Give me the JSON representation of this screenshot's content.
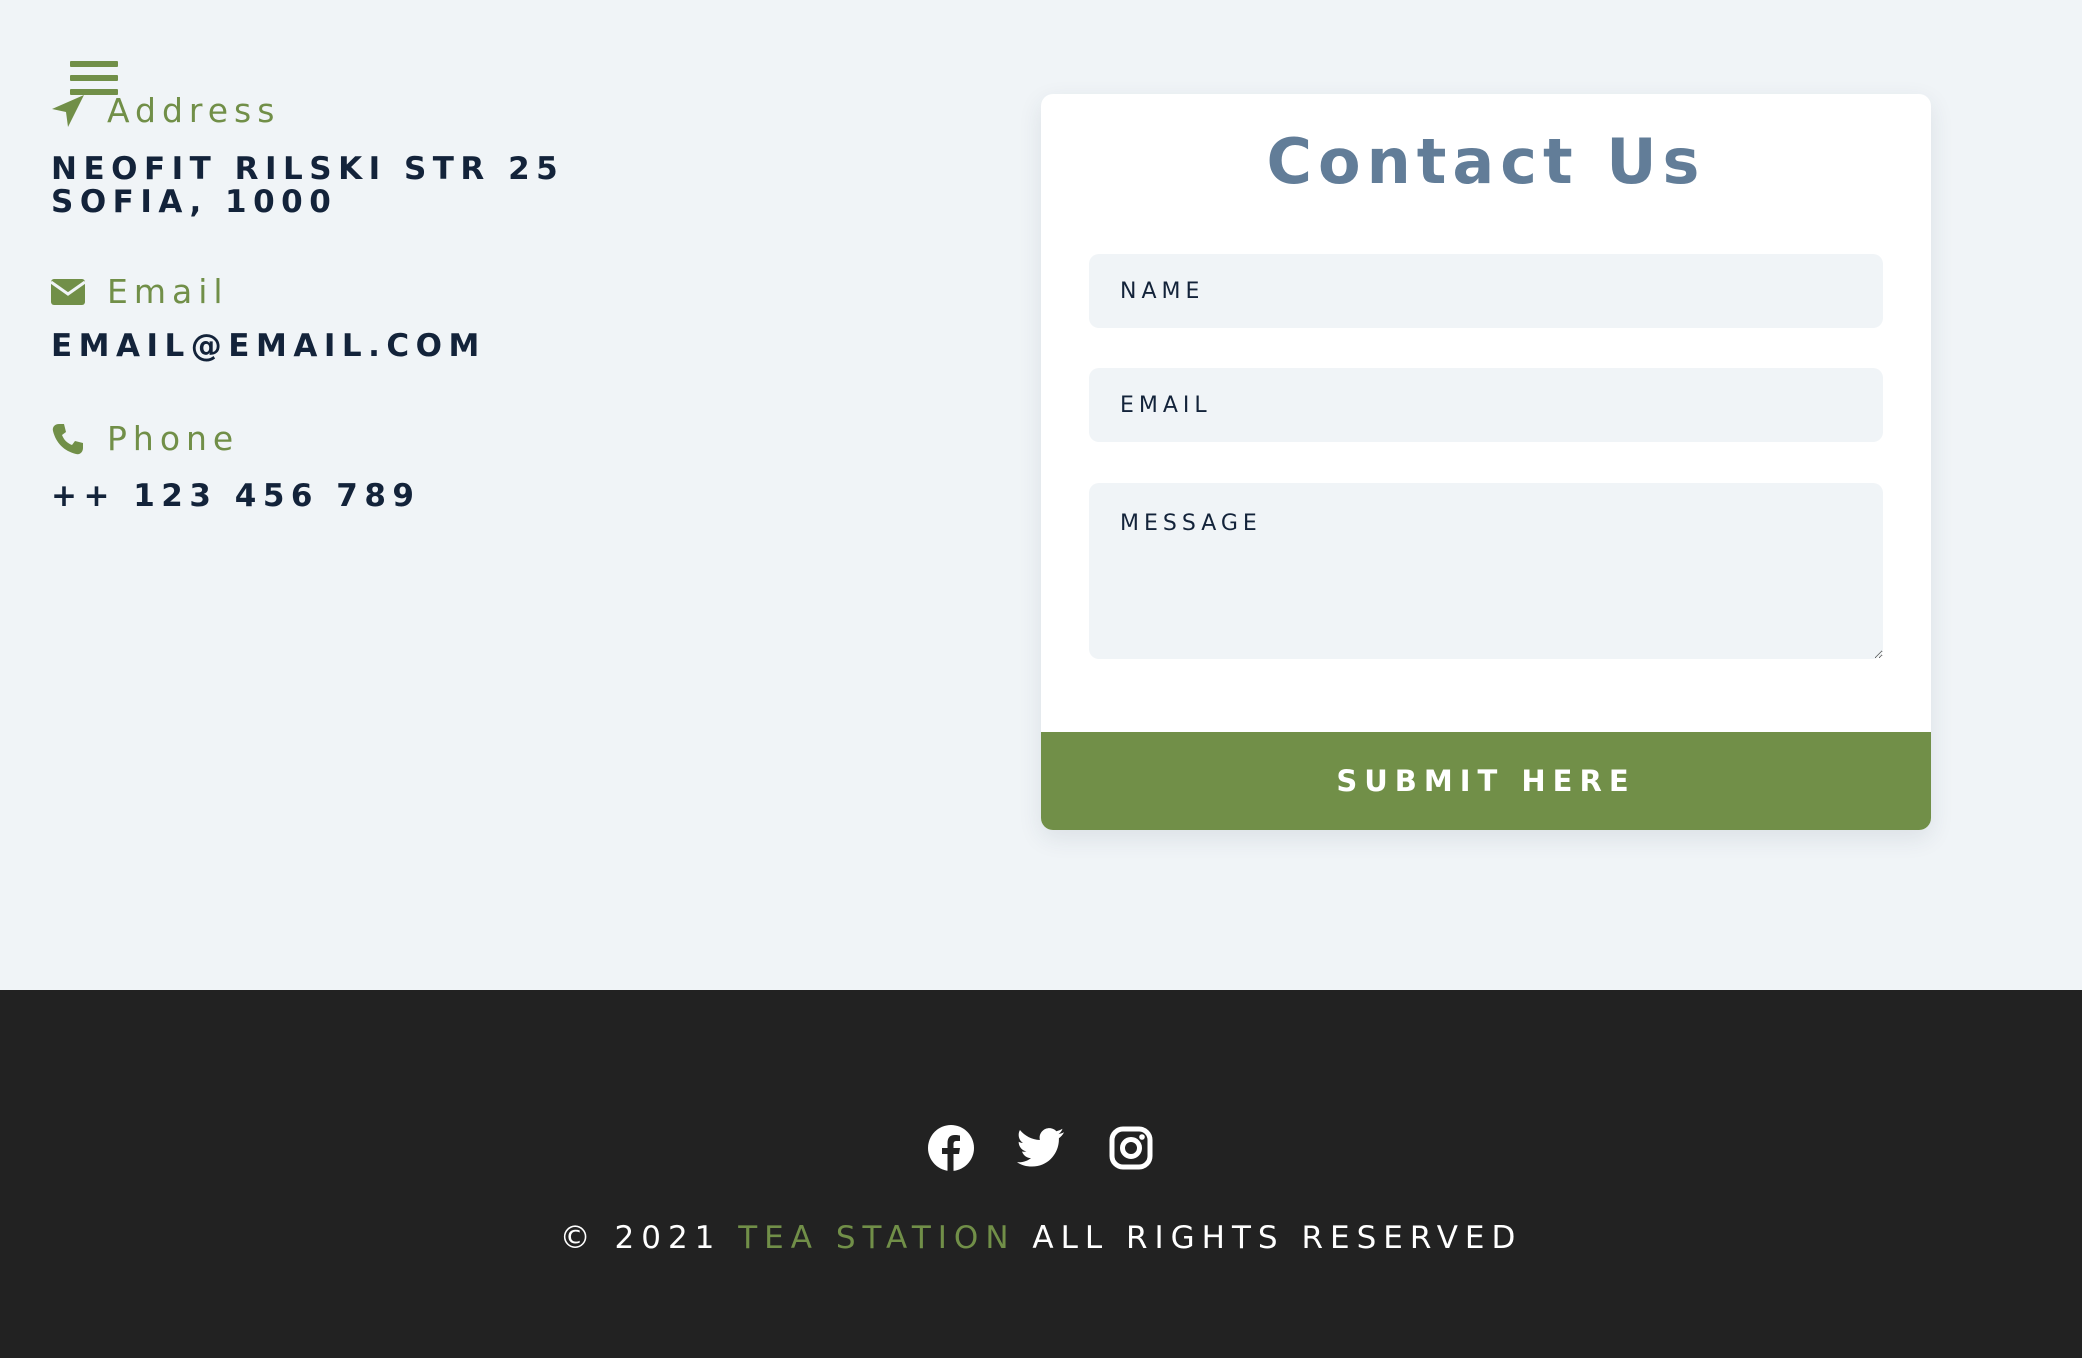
{
  "theme": {
    "accent": "#718f48",
    "page_bg": "#f0f4f7",
    "heading": "#627d98",
    "text_dark": "#13233a",
    "footer_bg": "#222222"
  },
  "nav": {
    "menu_icon": "hamburger-menu-icon"
  },
  "contact_info": {
    "address": {
      "icon": "location-arrow-icon",
      "label": "Address",
      "line1": "NEOFIT RILSKI STR 25",
      "line2": "SOFIA, 1000"
    },
    "email": {
      "icon": "envelope-icon",
      "label": "Email",
      "value": "EMAIL@EMAIL.COM"
    },
    "phone": {
      "icon": "phone-icon",
      "label": "Phone",
      "value": "++ 123 456 789"
    }
  },
  "form": {
    "title": "Contact Us",
    "name_placeholder": "NAME",
    "email_placeholder": "EMAIL",
    "message_placeholder": "MESSAGE",
    "submit_label": "SUBMIT HERE"
  },
  "footer": {
    "socials": [
      {
        "icon": "facebook-icon"
      },
      {
        "icon": "twitter-icon"
      },
      {
        "icon": "instagram-icon"
      }
    ],
    "copyright_prefix": "© 2021",
    "brand": "TEA STATION",
    "copyright_suffix": "ALL RIGHTS RESERVED"
  }
}
